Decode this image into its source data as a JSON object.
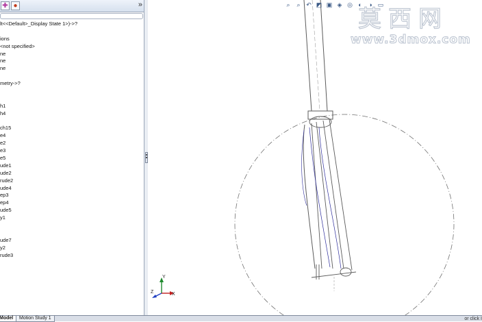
{
  "panel": {
    "toolbar_icons": [
      "config-icon",
      "display-manager-icon"
    ],
    "expand_glyph": "»",
    "tree_items": [
      "lt<<Default>_Display State 1>)->?",
      "",
      "ions",
      "<not specified>",
      "ne",
      "ne",
      "ne",
      "",
      "metry->?",
      "",
      "",
      "h1",
      "h4",
      "",
      "ch15",
      "e4",
      "e2",
      "e3",
      "e5",
      "ude1",
      "ude2",
      "rude2",
      "ude4",
      "ep3",
      "ep4",
      "ude5",
      "y1",
      "",
      "",
      "ude7",
      "y2",
      "rude3"
    ]
  },
  "heads_up_toolbar": [
    "zoom-to-fit-icon",
    "zoom-area-icon",
    "previous-view-icon",
    "section-view-icon",
    "view-orientation-icon",
    "display-style-icon",
    "hide-show-icon",
    "edit-appearance-icon",
    "apply-scene-icon",
    "view-settings-icon"
  ],
  "watermark": {
    "cn": "莫西网",
    "url": "www.3dmox.com"
  },
  "triad": {
    "x": "X",
    "y": "Y",
    "z": "Z"
  },
  "bottom_tabs": [
    {
      "label": "Model",
      "active": true
    },
    {
      "label": "Motion Study 1",
      "active": false
    }
  ],
  "status_hint": "or click I",
  "colors": {
    "panel_border": "#9aa6b8",
    "model_edges": "#5a5a5a",
    "sketch_blue": "#2a2a9a"
  }
}
